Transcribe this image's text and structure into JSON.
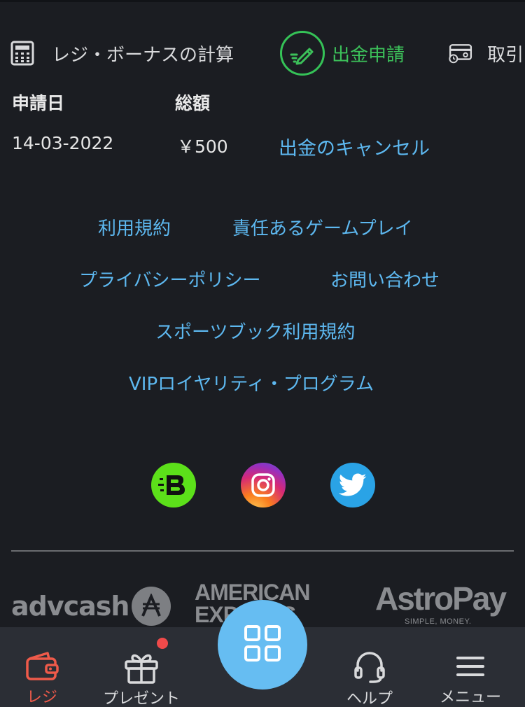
{
  "tabs": {
    "calc_label": "レジ・ボーナスの計算",
    "withdraw_label": "出金申請",
    "transactions_label": "取引"
  },
  "table": {
    "headers": [
      "申請日",
      "総額"
    ],
    "rows": [
      {
        "date": "14-03-2022",
        "amount": "￥500",
        "action": "出金のキャンセル"
      }
    ]
  },
  "footer_links": {
    "terms": "利用規約",
    "responsible": "責任あるゲームプレイ",
    "privacy": "プライバシーポリシー",
    "contact": "お問い合わせ",
    "sportsbook": "スポーツブック利用規約",
    "vip": "VIPロイヤリティ・プログラム"
  },
  "social": [
    "b-logo-icon",
    "instagram-icon",
    "twitter-icon"
  ],
  "payments": {
    "advcash": "advcash",
    "amex_line1": "AMERICAN",
    "amex_line2": "EXPRESS",
    "astropay": "AstroPay",
    "astropay_tagline": "SIMPLE, MONEY."
  },
  "bottom_nav": {
    "cashier": "レジ",
    "present": "プレゼント",
    "help": "ヘルプ",
    "menu": "メニュー"
  },
  "colors": {
    "background": "#1b1d22",
    "accent_green": "#3cc15a",
    "link_blue": "#5db8f0",
    "active_red": "#ef5a4a",
    "nav_bg": "#2b2e35",
    "fab_blue": "#66bdf2"
  }
}
